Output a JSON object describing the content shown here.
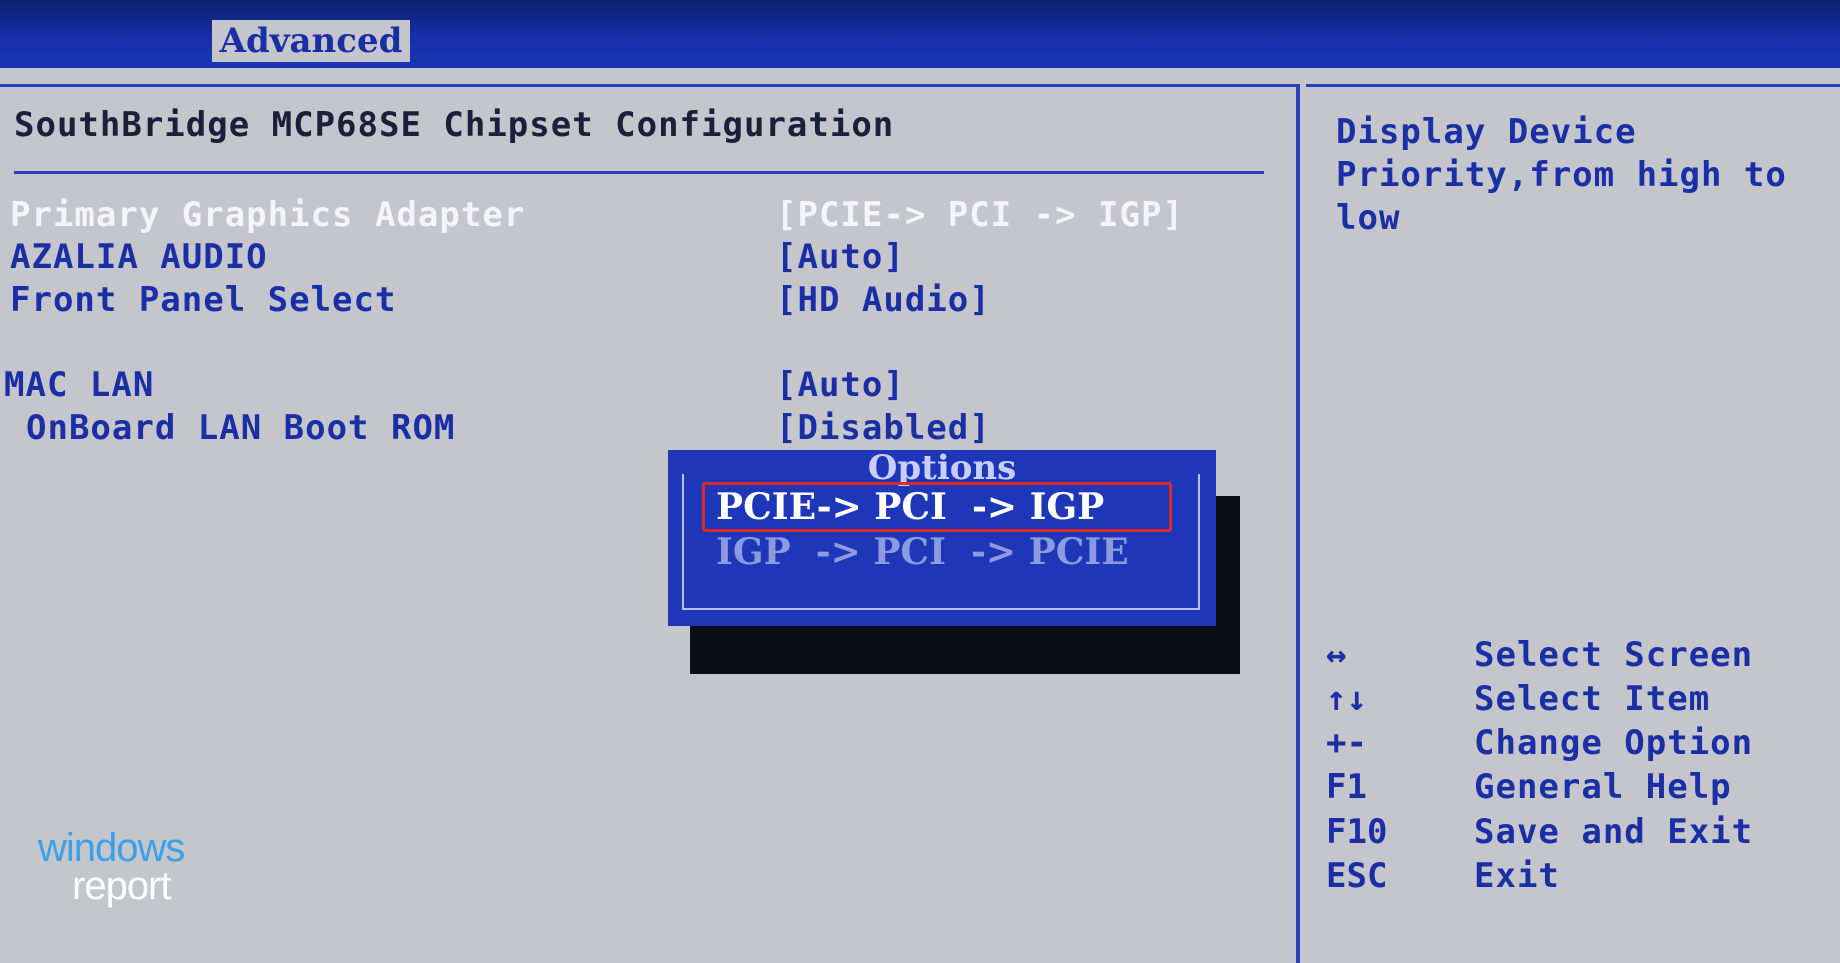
{
  "menu": {
    "tab_label": "Advanced"
  },
  "main": {
    "title": "SouthBridge MCP68SE Chipset Configuration",
    "rows": [
      {
        "label": "Primary Graphics Adapter",
        "value": "[PCIE-> PCI  -> IGP]"
      },
      {
        "label": "AZALIA AUDIO",
        "value": "[Auto]"
      },
      {
        "label": "Front Panel Select",
        "value": "[HD Audio]"
      },
      {
        "label": "MAC LAN",
        "value": "[Auto]"
      },
      {
        "label": "OnBoard LAN Boot ROM",
        "value": "[Disabled]"
      }
    ]
  },
  "popup": {
    "title": "Options",
    "options": [
      "PCIE-> PCI  -> IGP",
      "IGP  -> PCI  -> PCIE"
    ],
    "selected_index": 0
  },
  "help": {
    "text": "Display Device Priority,from high to low",
    "keys": [
      {
        "key": "↔",
        "desc": "Select Screen",
        "icon": "left-right-arrow-icon"
      },
      {
        "key": "↑↓",
        "desc": "Select Item",
        "icon": "up-down-arrow-icon"
      },
      {
        "key": "+-",
        "desc": "Change Option",
        "icon": "plus-minus-icon"
      },
      {
        "key": "F1",
        "desc": "General Help"
      },
      {
        "key": "F10",
        "desc": "Save and Exit"
      },
      {
        "key": "ESC",
        "desc": "Exit"
      }
    ]
  },
  "watermark": {
    "line1": "windows",
    "line2": "report"
  },
  "colors": {
    "background": "#c4c6cb",
    "bios_blue": "#1a2fa6",
    "popup_blue": "#1d37b8",
    "highlight_red": "#e0282a",
    "logo_blue": "#3aa0e8"
  }
}
